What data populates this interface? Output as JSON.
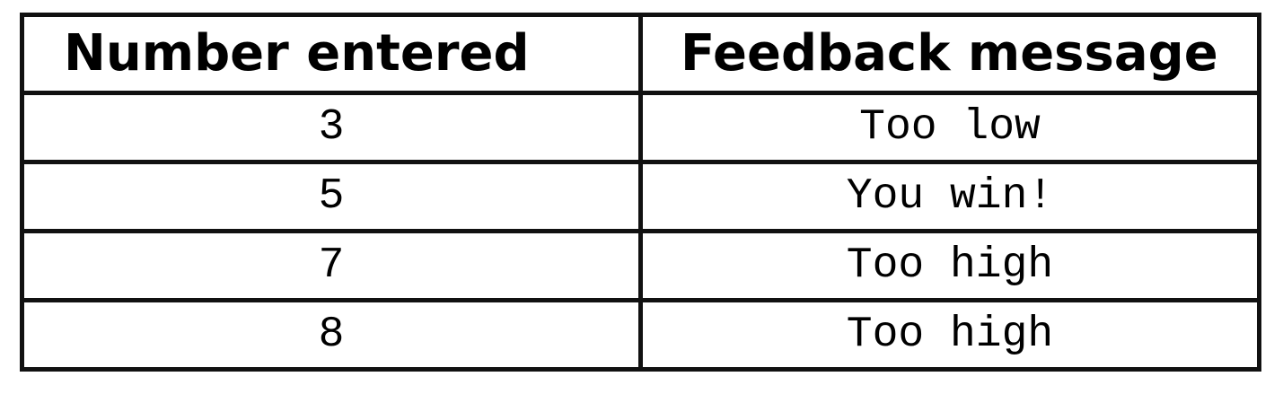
{
  "table": {
    "headers": [
      "Number entered",
      "Feedback message"
    ],
    "rows": [
      [
        "3",
        "Too low"
      ],
      [
        "5",
        "You win!"
      ],
      [
        "7",
        "Too high"
      ],
      [
        "8",
        "Too high"
      ]
    ]
  }
}
